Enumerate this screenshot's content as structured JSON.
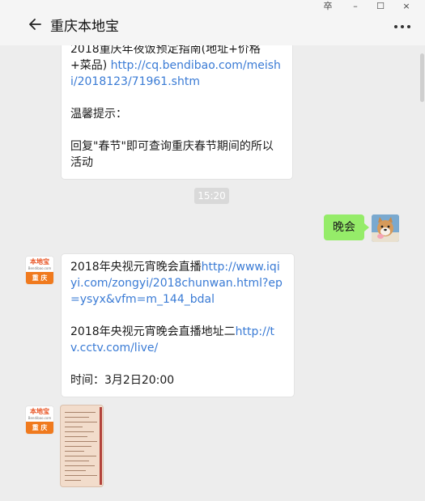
{
  "window": {
    "title": "重庆本地宝",
    "pin_label": "卒",
    "min_label": "–",
    "max_label": "☐",
    "close_label": "×"
  },
  "messages": {
    "first": {
      "line1": "2018重庆年夜饭预定指南(地址+价格+菜品)",
      "link1": "http://cq.bendibao.com/meishi/2018123/71961.shtm",
      "tip_title": "温馨提示：",
      "tip_body": "回复\"春节\"即可查询重庆春节期间的所以活动"
    },
    "timestamp": "15:20",
    "mine": {
      "text": "晚会"
    },
    "second": {
      "text1": "2018年央视元宵晚会直播",
      "link1": "http://www.iqiyi.com/zongyi/2018chunwan.html?ep=ysyx&vfm=m_144_bdal",
      "text2": "2018年央视元宵晚会直播地址二",
      "link2": "http://tv.cctv.com/live/",
      "time_line": "时间：3月2日20:00"
    }
  },
  "avatar": {
    "brand": "本地宝",
    "brand_sub": "Bendibao.com",
    "city": "重 庆"
  },
  "colors": {
    "my_bubble": "#95ec69",
    "link": "#3a7bd5",
    "brand_orange": "#f07a1e"
  }
}
